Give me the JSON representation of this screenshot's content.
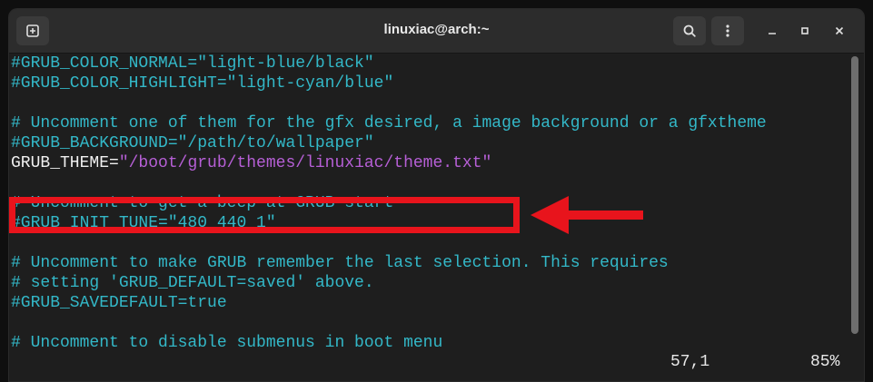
{
  "window": {
    "title": "linuxiac@arch:~",
    "icons": {
      "new_tab": "new-tab-icon",
      "search": "search-icon",
      "menu": "kebab-menu-icon",
      "minimize": "minimize-icon",
      "maximize": "maximize-icon",
      "close": "close-icon"
    }
  },
  "editor": {
    "lines": [
      {
        "text": "#GRUB_COLOR_NORMAL=\"light-blue/black\""
      },
      {
        "text": "#GRUB_COLOR_HIGHLIGHT=\"light-cyan/blue\""
      },
      {
        "text": ""
      },
      {
        "text": "# Uncomment one of them for the gfx desired, a image background or a gfxtheme"
      },
      {
        "text": "#GRUB_BACKGROUND=\"/path/to/wallpaper\""
      },
      {
        "key": "GRUB_THEME=",
        "value": "\"/boot/grub/themes/linuxiac/theme.txt\""
      },
      {
        "text": ""
      },
      {
        "text": "# Uncomment to get a beep at GRUB start"
      },
      {
        "text": "#GRUB_INIT_TUNE=\"480 440 1\""
      },
      {
        "text": ""
      },
      {
        "text": "# Uncomment to make GRUB remember the last selection. This requires"
      },
      {
        "text": "# setting 'GRUB_DEFAULT=saved' above."
      },
      {
        "text": "#GRUB_SAVEDEFAULT=true"
      },
      {
        "text": ""
      },
      {
        "text": "# Uncomment to disable submenus in boot menu"
      }
    ],
    "status": {
      "position": "57,1",
      "percent": "85%"
    }
  },
  "colors": {
    "comment": "#33b8c8",
    "string": "#b65fd6",
    "highlight": "#e8141c"
  }
}
